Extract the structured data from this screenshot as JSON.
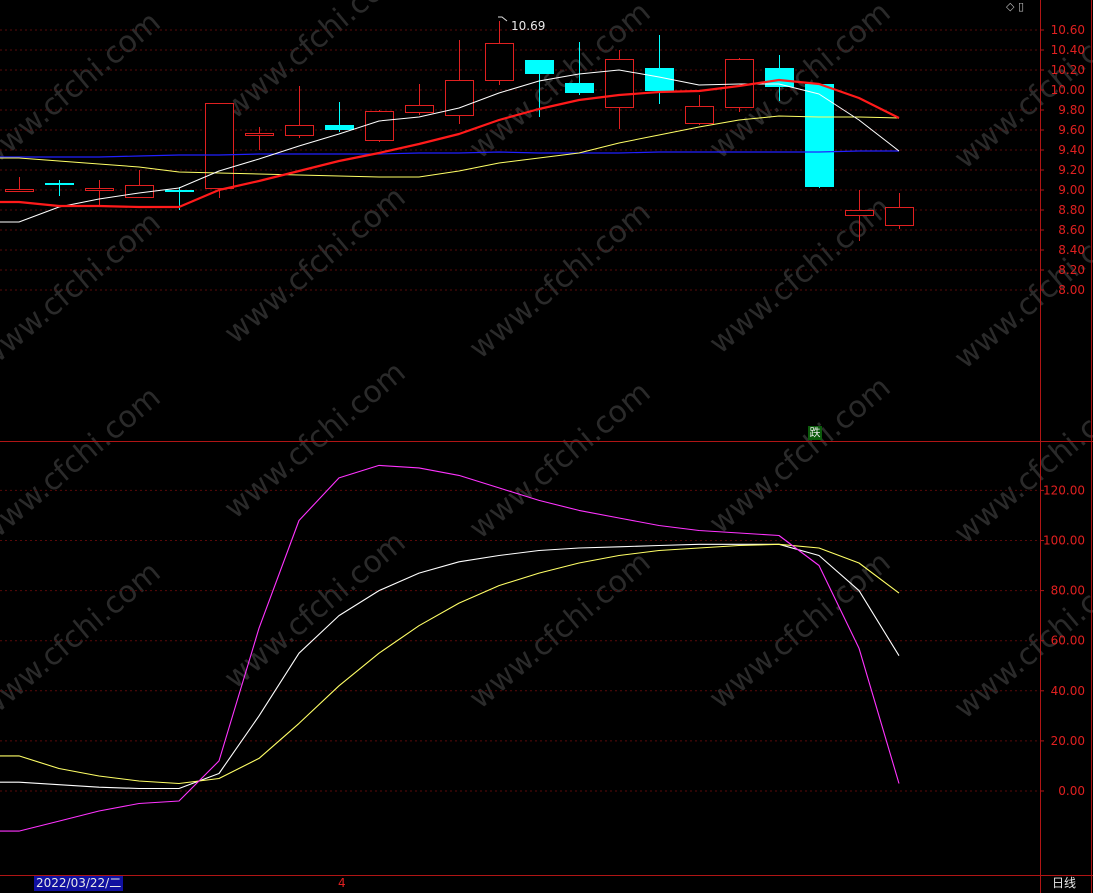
{
  "chart_data": [
    {
      "type": "candlestick",
      "ylim": [
        7.95,
        10.75
      ],
      "y_ticks": [
        "10.60",
        "10.40",
        "10.20",
        "10.00",
        "9.80",
        "9.60",
        "9.40",
        "9.20",
        "9.00",
        "8.80",
        "8.60",
        "8.40",
        "8.20",
        "8.00"
      ],
      "max_annotation": "10.69",
      "colors": {
        "up": "#e02020",
        "down": "#00ffff",
        "ma_short": "#ffffff",
        "ma_mid": "#ff1a1a",
        "ma_long": "#ffff66",
        "ma_longest": "#2020ff"
      },
      "candles": [
        {
          "o": 9.01,
          "h": 9.13,
          "l": 8.98,
          "c": 9.01
        },
        {
          "o": 9.07,
          "h": 9.1,
          "l": 8.94,
          "c": 9.05
        },
        {
          "o": 9.02,
          "h": 9.1,
          "l": 8.85,
          "c": 9.02
        },
        {
          "o": 8.93,
          "h": 9.2,
          "l": 8.92,
          "c": 9.05
        },
        {
          "o": 9.0,
          "h": 9.03,
          "l": 8.8,
          "c": 8.99
        },
        {
          "o": 9.02,
          "h": 9.87,
          "l": 8.92,
          "c": 9.87
        },
        {
          "o": 9.55,
          "h": 9.63,
          "l": 9.4,
          "c": 9.57
        },
        {
          "o": 9.55,
          "h": 10.04,
          "l": 9.52,
          "c": 9.65
        },
        {
          "o": 9.65,
          "h": 9.88,
          "l": 9.58,
          "c": 9.6
        },
        {
          "o": 9.5,
          "h": 9.8,
          "l": 9.48,
          "c": 9.79
        },
        {
          "o": 9.78,
          "h": 10.06,
          "l": 9.75,
          "c": 9.85
        },
        {
          "o": 9.75,
          "h": 10.5,
          "l": 9.66,
          "c": 10.1
        },
        {
          "o": 10.1,
          "h": 10.69,
          "l": 10.05,
          "c": 10.47
        },
        {
          "o": 10.3,
          "h": 10.3,
          "l": 9.73,
          "c": 10.16
        },
        {
          "o": 10.07,
          "h": 10.48,
          "l": 9.95,
          "c": 9.97
        },
        {
          "o": 9.83,
          "h": 10.4,
          "l": 9.61,
          "c": 10.31
        },
        {
          "o": 10.22,
          "h": 10.55,
          "l": 9.86,
          "c": 9.99
        },
        {
          "o": 9.67,
          "h": 9.95,
          "l": 9.65,
          "c": 9.84
        },
        {
          "o": 9.83,
          "h": 10.32,
          "l": 9.78,
          "c": 10.31
        },
        {
          "o": 10.22,
          "h": 10.35,
          "l": 9.89,
          "c": 10.03
        },
        {
          "o": 10.06,
          "h": 10.06,
          "l": 9.02,
          "c": 9.03
        },
        {
          "o": 8.75,
          "h": 9.0,
          "l": 8.49,
          "c": 8.8
        },
        {
          "o": 8.65,
          "h": 8.97,
          "l": 8.61,
          "c": 8.83
        }
      ],
      "ma_short": [
        8.68,
        8.83,
        8.91,
        8.97,
        9.02,
        9.19,
        9.31,
        9.44,
        9.56,
        9.69,
        9.73,
        9.82,
        9.97,
        10.09,
        10.16,
        10.2,
        10.13,
        10.05,
        10.06,
        10.06,
        9.96,
        9.7,
        9.39
      ],
      "ma_mid": [
        8.88,
        8.84,
        8.84,
        8.83,
        8.83,
        9.0,
        9.09,
        9.19,
        9.29,
        9.37,
        9.46,
        9.56,
        9.7,
        9.81,
        9.9,
        9.95,
        9.98,
        9.99,
        10.04,
        10.1,
        10.06,
        9.92,
        9.72
      ],
      "ma_long": [
        9.32,
        9.29,
        9.26,
        9.23,
        9.18,
        9.17,
        9.16,
        9.15,
        9.14,
        9.13,
        9.13,
        9.19,
        9.27,
        9.32,
        9.37,
        9.47,
        9.55,
        9.63,
        9.7,
        9.74,
        9.73,
        9.73,
        9.72
      ],
      "ma_longest": [
        9.33,
        9.33,
        9.33,
        9.34,
        9.35,
        9.35,
        9.36,
        9.36,
        9.36,
        9.36,
        9.37,
        9.37,
        9.38,
        9.37,
        9.37,
        9.37,
        9.38,
        9.38,
        9.38,
        9.38,
        9.38,
        9.39,
        9.39
      ]
    },
    {
      "type": "line",
      "ylim": [
        -20,
        138
      ],
      "y_ticks": [
        "120.00",
        "100.00",
        "80.00",
        "60.00",
        "40.00",
        "20.00",
        "0.00"
      ],
      "series": [
        {
          "color": "#ffffff",
          "values": [
            3.5,
            2.5,
            1.5,
            1,
            1,
            7,
            30,
            55,
            70,
            80,
            87,
            91.5,
            94,
            96,
            97,
            97.5,
            98,
            98.5,
            98.5,
            98.5,
            94,
            80,
            54
          ]
        },
        {
          "color": "#ffff66",
          "values": [
            14,
            9,
            6,
            4,
            3,
            5,
            13,
            27,
            42,
            55,
            66,
            75,
            82,
            87,
            91,
            94,
            96,
            97,
            98,
            98.5,
            97,
            91,
            79
          ]
        },
        {
          "color": "#ff33ff",
          "values": [
            -16,
            -12,
            -8,
            -5,
            -4,
            12,
            65,
            108,
            125,
            130,
            129,
            126,
            121,
            116,
            112,
            109,
            106,
            104,
            103,
            102,
            90,
            57,
            3
          ]
        }
      ]
    }
  ],
  "footer": {
    "date": "2022/03/22/二",
    "month": "4",
    "period": "日线"
  },
  "badges": {
    "drop": "跌"
  },
  "watermark": "www.cfchi.com",
  "icons": [
    "diamond-icon",
    "square-icon"
  ]
}
